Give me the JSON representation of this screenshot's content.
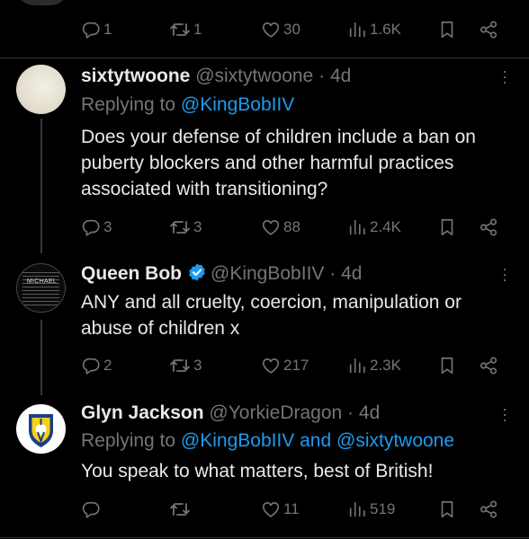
{
  "top_tweet": {
    "actions": {
      "replies": "1",
      "reposts": "1",
      "likes": "30",
      "views": "1.6K"
    }
  },
  "tweets": [
    {
      "name": "sixtytwoone",
      "handle": "@sixtytwoone",
      "separator": "·",
      "age": "4d",
      "replying_prefix": "Replying to",
      "replying_to": "@KingBobIIV",
      "text": "Does your defense of children include a ban on puberty blockers and other harmful practices associated with transitioning?",
      "actions": {
        "replies": "3",
        "reposts": "3",
        "likes": "88",
        "views": "2.4K"
      }
    },
    {
      "name": "Queen Bob",
      "handle": "@KingBobIIV",
      "separator": "·",
      "age": "4d",
      "verified": true,
      "avatar_text": "MICHAEL",
      "text": "ANY and all cruelty, coercion, manipulation or abuse of children x",
      "actions": {
        "replies": "2",
        "reposts": "3",
        "likes": "217",
        "views": "2.3K"
      }
    },
    {
      "name": "Glyn Jackson",
      "handle": "@YorkieDragon",
      "separator": "·",
      "age": "4d",
      "replying_prefix": "Replying to",
      "replying_to": "@KingBobIIV and @sixtytwoone",
      "text": "You speak to what matters, best of British!",
      "actions": {
        "replies": "",
        "reposts": "",
        "likes": "11",
        "views": "519"
      }
    }
  ],
  "colors": {
    "background": "#000000",
    "text": "#e7e9ea",
    "muted": "#71767b",
    "link": "#1d9bf0",
    "divider": "#2f3336",
    "verified": "#1d9bf0"
  },
  "icons": {
    "reply": "reply-icon",
    "repost": "repost-icon",
    "like": "like-icon",
    "views": "views-icon",
    "bookmark": "bookmark-icon",
    "share": "share-icon",
    "more": "more-icon",
    "verified": "verified-badge-icon"
  }
}
